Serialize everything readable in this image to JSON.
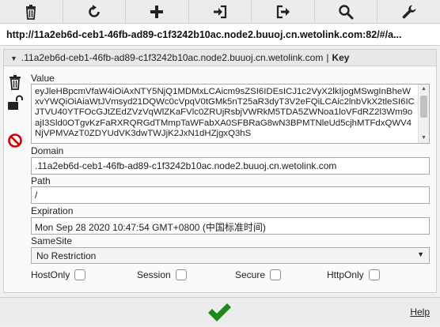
{
  "toolbar": {
    "buttons": [
      {
        "icon": "trash-icon",
        "name": "delete-all-button"
      },
      {
        "icon": "refresh-icon",
        "name": "refresh-button"
      },
      {
        "icon": "plus-icon",
        "name": "add-cookie-button"
      },
      {
        "icon": "import-icon",
        "name": "import-button"
      },
      {
        "icon": "export-icon",
        "name": "export-button"
      },
      {
        "icon": "search-icon",
        "name": "search-button"
      },
      {
        "icon": "wrench-icon",
        "name": "options-button"
      }
    ]
  },
  "url": "http://11a2eb6d-ceb1-46fb-ad89-c1f3242b10ac.node2.buuoj.cn.wetolink.com:82/#/a...",
  "cookie": {
    "header_domain": ".11a2eb6d-ceb1-46fb-ad89-c1f3242b10ac.node2.buuoj.cn.wetolink.com",
    "header_sep": "|",
    "name": "Key"
  },
  "form": {
    "value_label": "Value",
    "value": "eyJleHBpcmVfaW4iOiAxNTY5NjQ1MDMxLCAicm9sZSI6IDEsICJ1c2VyX2lkIjogMSwgInBheWxvYWQiOiAiaWtJVmsyd21DQWc0cVpqV0tGMk5nT25aR3dyT3V2eFQiLCAic2lnbVkX2tleSI6ICJTVU40YTFOcGJtZEdZVzVqWlZKaFVlc0ZRUjRsbjVWRkM5TDA5ZWNoa1loVFdRZ2l3Wm9oajI3Sld0OTgvKzFaRXRQRGdTMmpTaWFabXA0SFBRaG8wN3BPMTNleUd5cjhMTFdxQWV4NjVPMVAzT0ZDYUdVK3dwTWJjK2JxN1dHZjgxQ3hS",
    "domain_label": "Domain",
    "domain": ".11a2eb6d-ceb1-46fb-ad89-c1f3242b10ac.node2.buuoj.cn.wetolink.com",
    "path_label": "Path",
    "path": "/",
    "expiration_label": "Expiration",
    "expiration": "Mon Sep 28 2020 10:47:54 GMT+0800 (中国标准时间)",
    "samesite_label": "SameSite",
    "samesite_selected": "No Restriction",
    "hostonly_label": "HostOnly",
    "session_label": "Session",
    "secure_label": "Secure",
    "httponly_label": "HttpOnly"
  },
  "footer": {
    "help_label": "Help"
  },
  "colors": {
    "save_green": "#1a8a1a",
    "block_red": "#d40000",
    "icon_dark": "#222222"
  }
}
